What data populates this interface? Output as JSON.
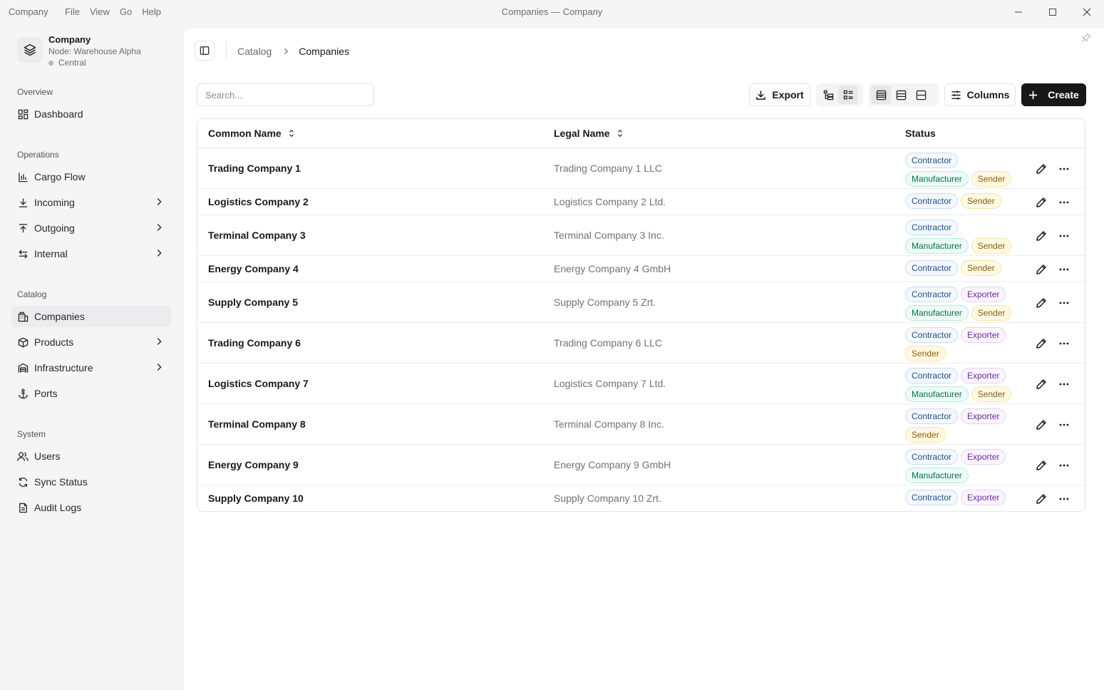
{
  "window": {
    "app_name": "Company",
    "menu": [
      "File",
      "View",
      "Go",
      "Help"
    ],
    "title": "Companies — Company"
  },
  "sidebar": {
    "brand": {
      "name": "Company",
      "node": "Node: Warehouse Alpha",
      "location": "Central"
    },
    "sections": {
      "overview": "Overview",
      "operations": "Operations",
      "catalog": "Catalog",
      "system": "System"
    },
    "items": {
      "dashboard": "Dashboard",
      "cargo_flow": "Cargo Flow",
      "incoming": "Incoming",
      "outgoing": "Outgoing",
      "internal": "Internal",
      "companies": "Companies",
      "products": "Products",
      "infrastructure": "Infrastructure",
      "ports": "Ports",
      "users": "Users",
      "sync_status": "Sync Status",
      "audit_logs": "Audit Logs"
    }
  },
  "breadcrumb": {
    "parent": "Catalog",
    "current": "Companies"
  },
  "toolbar": {
    "search_placeholder": "Search...",
    "export_label": "Export",
    "columns_label": "Columns",
    "create_label": "Create"
  },
  "table": {
    "headers": {
      "common_name": "Common Name",
      "legal_name": "Legal Name",
      "status": "Status"
    },
    "rows": [
      {
        "name": "Trading Company 1",
        "legal": "Trading Company 1 LLC",
        "badges": [
          "Contractor",
          "Manufacturer",
          "Sender"
        ]
      },
      {
        "name": "Logistics Company 2",
        "legal": "Logistics Company 2 Ltd.",
        "badges": [
          "Contractor",
          "Sender"
        ]
      },
      {
        "name": "Terminal Company 3",
        "legal": "Terminal Company 3 Inc.",
        "badges": [
          "Contractor",
          "Manufacturer",
          "Sender"
        ]
      },
      {
        "name": "Energy Company 4",
        "legal": "Energy Company 4 GmbH",
        "badges": [
          "Contractor",
          "Sender"
        ]
      },
      {
        "name": "Supply Company 5",
        "legal": "Supply Company 5 Zrt.",
        "badges": [
          "Contractor",
          "Exporter",
          "Manufacturer",
          "Sender"
        ]
      },
      {
        "name": "Trading Company 6",
        "legal": "Trading Company 6 LLC",
        "badges": [
          "Contractor",
          "Exporter",
          "Sender"
        ]
      },
      {
        "name": "Logistics Company 7",
        "legal": "Logistics Company 7 Ltd.",
        "badges": [
          "Contractor",
          "Exporter",
          "Manufacturer",
          "Sender"
        ]
      },
      {
        "name": "Terminal Company 8",
        "legal": "Terminal Company 8 Inc.",
        "badges": [
          "Contractor",
          "Exporter",
          "Sender"
        ]
      },
      {
        "name": "Energy Company 9",
        "legal": "Energy Company 9 GmbH",
        "badges": [
          "Contractor",
          "Exporter",
          "Manufacturer"
        ]
      },
      {
        "name": "Supply Company 10",
        "legal": "Supply Company 10 Zrt.",
        "badges": [
          "Contractor",
          "Exporter"
        ]
      }
    ]
  },
  "colors": {
    "accent": "#18181b",
    "contractor": "#1f4f8a",
    "manufacturer": "#0f6b52",
    "sender": "#8a5c0f",
    "exporter": "#6b2a9c"
  }
}
